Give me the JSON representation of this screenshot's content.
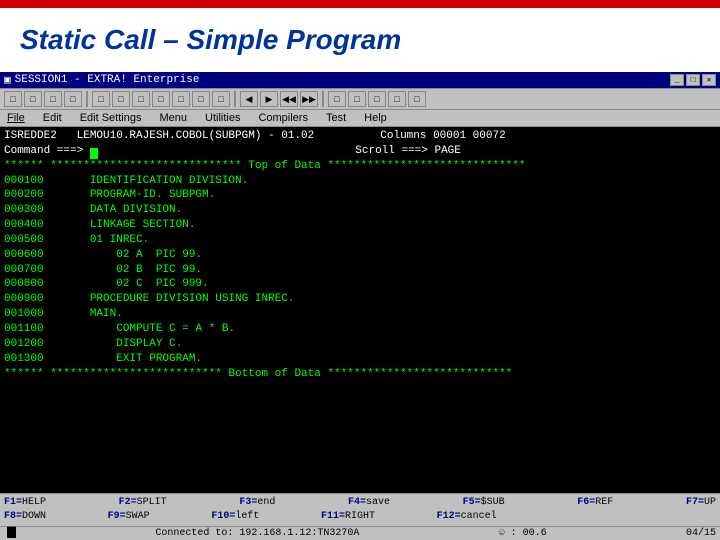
{
  "title": {
    "text": "Static Call – Simple Program",
    "accent_color": "#cc0000",
    "text_color": "#003399"
  },
  "window": {
    "title": "SESSION1 - EXTRA! Enterprise",
    "controls": [
      "▲",
      "▼",
      "✕"
    ]
  },
  "toolbar_icons": [
    "□",
    "□",
    "□",
    "□",
    "□",
    "□",
    "□",
    "□",
    "□",
    "□",
    "□",
    "□",
    "□",
    "□",
    "□",
    "□",
    "□",
    "□",
    "□",
    "□",
    "□",
    "□",
    "□",
    "□"
  ],
  "menu": {
    "items": [
      "File",
      "Edit",
      "Edit Settings",
      "Menu",
      "Utilities",
      "Compilers",
      "Test",
      "Help"
    ]
  },
  "terminal": {
    "info_line": "ISREDDE2   LEMOU10.RAJESH.COBOL(SUBPGM) - 01.02          Columns 00001 00072",
    "command_line": "Command ===>                                             Scroll ===> PAGE",
    "separator_top": "****** ***************************** Top of Data ******************************",
    "lines": [
      {
        "num": "000100",
        "code": "       IDENTIFICATION DIVISION."
      },
      {
        "num": "000200",
        "code": "       PROGRAM-ID. SUBPGM."
      },
      {
        "num": "000300",
        "code": "       DATA DIVISION."
      },
      {
        "num": "000400",
        "code": "       LINKAGE SECTION."
      },
      {
        "num": "000500",
        "code": "       01 INREC."
      },
      {
        "num": "000600",
        "code": "           02 A  PIC 99."
      },
      {
        "num": "000700",
        "code": "           02 B  PIC 99."
      },
      {
        "num": "000800",
        "code": "           02 C  PIC 999."
      },
      {
        "num": "000900",
        "code": "       PROCEDURE DIVISION USING INREC."
      },
      {
        "num": "001000",
        "code": "       MAIN."
      },
      {
        "num": "001100",
        "code": "           COMPUTE C = A * B."
      },
      {
        "num": "001200",
        "code": "           DISPLAY C."
      },
      {
        "num": "001300",
        "code": "           EXIT PROGRAM."
      }
    ],
    "separator_bottom": "****** ************************** Bottom of Data ****************************",
    "blank_line": ""
  },
  "fkeys": {
    "row1": [
      {
        "num": "F1=",
        "label": "HELP"
      },
      {
        "num": "F2=",
        "label": "SPLIT"
      },
      {
        "num": "F3=",
        "label": "end"
      },
      {
        "num": "F4=",
        "label": "save"
      },
      {
        "num": "F5=",
        "label": "$SUB"
      },
      {
        "num": "F6=",
        "label": "REF"
      },
      {
        "num": "F7=",
        "label": "UP"
      }
    ],
    "row2": [
      {
        "num": "F8=",
        "label": "DOWN"
      },
      {
        "num": "F9=",
        "label": "SWAP"
      },
      {
        "num": "F10=",
        "label": "left"
      },
      {
        "num": "F11=",
        "label": "RIGHT"
      },
      {
        "num": "F12=",
        "label": "cancel"
      }
    ]
  },
  "status_bottom": {
    "left": "▐█",
    "center": "☺ : 00.6",
    "right": "04/15"
  },
  "connected_text": "Connected to: 192.168.1.12:TN3270A"
}
